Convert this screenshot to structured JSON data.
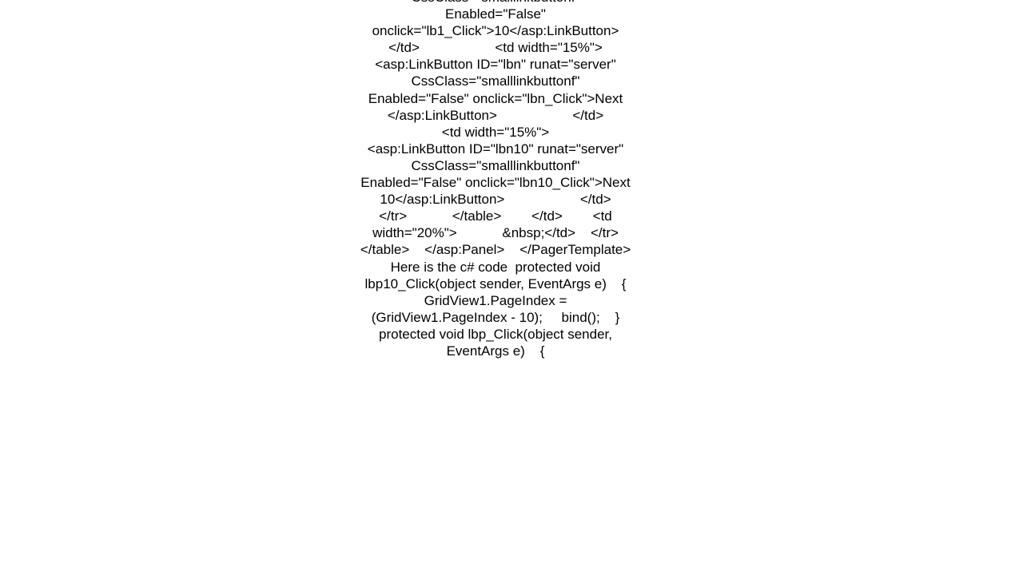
{
  "page": {
    "background_color": "#ffffff",
    "text_color": "#000000",
    "alignment": "center",
    "font_size_px": 17,
    "line_height_px": 21,
    "clipped_top": true,
    "clipped_bottom": true
  },
  "content": {
    "kind": "code-prose-block",
    "language_hint": "aspx-markup-and-csharp",
    "full_text": "CssClass=\"smalllinkbuttonf\" Enabled=\"False\" onclick=\"lb1_Click\">10</asp:LinkButton>                    </td>                    <td width=\"15%\">                        <asp:LinkButton ID=\"lbn\" runat=\"server\" CssClass=\"smalllinkbuttonf\" Enabled=\"False\" onclick=\"lbn_Click\">Next </asp:LinkButton>                    </td>                    <td width=\"15%\">                        <asp:LinkButton ID=\"lbn10\" runat=\"server\" CssClass=\"smalllinkbuttonf\" Enabled=\"False\" onclick=\"lbn10_Click\">Next 10</asp:LinkButton>                    </td>                </tr>            </table>        </td>        <td width=\"20%\">            &nbsp;</td>    </tr>    </table>    </asp:Panel>    </PagerTemplate>  Here is the c# code  protected void lbp10_Click(object sender, EventArgs e)    {        GridView1.PageIndex = (GridView1.PageIndex - 10);     bind();    }  protected void lbp_Click(object sender, EventArgs e)    {",
    "visible_lines": [
      "CssClass=\"smalllinkbuttonf\"",
      "Enabled=\"False\"",
      "onclick=\"lb1_Click\">10</asp:LinkButton>",
      "</td>",
      "<td width=\"15%\">",
      "<asp:LinkButton ID=\"lbn\" runat=\"server\"",
      "CssClass=\"smalllinkbuttonf\"",
      "Enabled=\"False\" onclick=\"lbn_Click\">Next",
      "</asp:LinkButton>",
      "</td>",
      "<td width=\"15%\">",
      "<asp:LinkButton ID=\"lbn10\"",
      "runat=\"server\"",
      "CssClass=\"smalllinkbuttonf\"",
      "Enabled=\"False\"",
      "onclick=\"lbn10_Click\">Next",
      "10</asp:LinkButton>",
      "</td>",
      "</tr>",
      "</table>",
      "</td>",
      "<td width=\"20%\">",
      "&nbsp;</td>",
      "</tr>",
      "</table>",
      "</asp:Panel>",
      "</PagerTemplate>  Here is the c# code",
      "protected void lbp10_Click(object",
      "sender, EventArgs e) {",
      "GridView1.PageIndex =",
      "(GridView1.PageIndex - 10);    bind();",
      "} protected void lbp_Click(object",
      "sender, EventArgs e) {"
    ]
  }
}
